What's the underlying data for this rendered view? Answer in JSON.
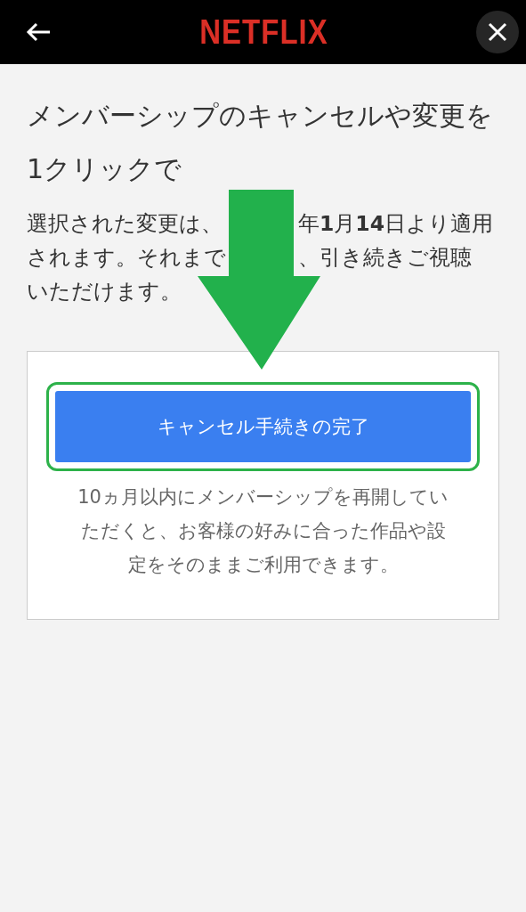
{
  "header": {
    "logo": "NETFLIX"
  },
  "title": "メンバーシップのキャンセルや変更を1クリックで",
  "notice": {
    "lines": [
      {
        "left": "選択された変更は、",
        "right": "年**1**月**14**日より適用"
      },
      {
        "left": "されます。それまで",
        "right": "、引き続きご視聴"
      },
      {
        "left": "いただけます。"
      }
    ]
  },
  "card": {
    "button": "キャンセル手続きの完了",
    "note": "10ヵ月以内にメンバーシップを再開していただくと、お客様の好みに合った作品や設定をそのままご利用できます。"
  }
}
